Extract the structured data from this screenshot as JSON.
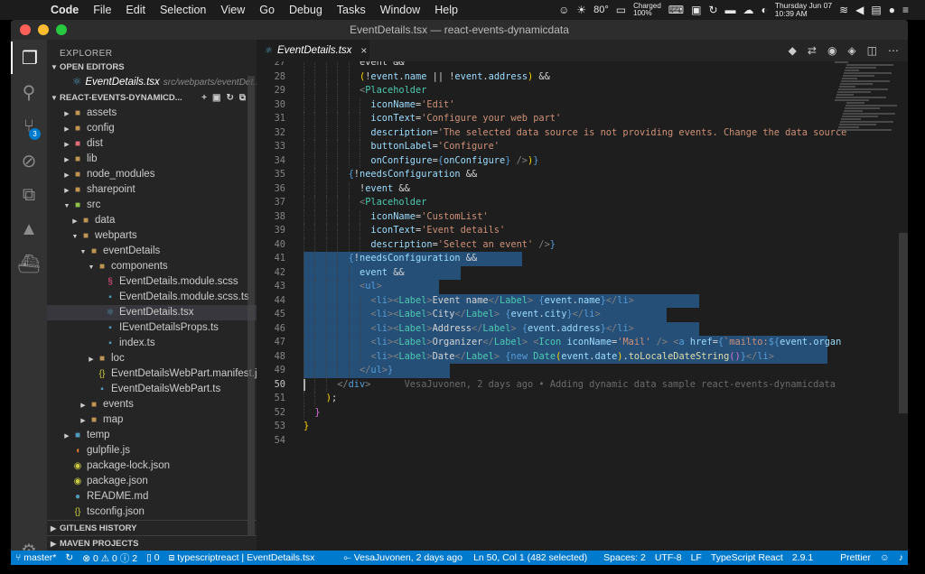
{
  "menubar": {
    "app": "Code",
    "items": [
      "File",
      "Edit",
      "Selection",
      "View",
      "Go",
      "Debug",
      "Tasks",
      "Window",
      "Help"
    ],
    "temperature": "80°",
    "battery": "Charged\n100%",
    "clock": "Thursday Jun 07\n10:39 AM"
  },
  "window": {
    "title": "EventDetails.tsx — react-events-dynamicdata"
  },
  "activity": {
    "scm_badge": "3"
  },
  "sidebar": {
    "title": "EXPLORER",
    "open_editors_label": "OPEN EDITORS",
    "open_editor_file": "EventDetails.tsx",
    "open_editor_path": "src/webparts/eventDet...",
    "project_label": "REACT-EVENTS-DYNAMICD...",
    "tree": [
      {
        "label": "assets",
        "indent": 1,
        "type": "folder",
        "twisty": "▶"
      },
      {
        "label": "config",
        "indent": 1,
        "type": "folder",
        "twisty": "▶"
      },
      {
        "label": "dist",
        "indent": 1,
        "type": "folder-red",
        "twisty": "▶"
      },
      {
        "label": "lib",
        "indent": 1,
        "type": "folder",
        "twisty": "▶"
      },
      {
        "label": "node_modules",
        "indent": 1,
        "type": "folder",
        "twisty": "▶"
      },
      {
        "label": "sharepoint",
        "indent": 1,
        "type": "folder",
        "twisty": "▶"
      },
      {
        "label": "src",
        "indent": 1,
        "type": "folder-src",
        "twisty": "▼"
      },
      {
        "label": "data",
        "indent": 2,
        "type": "folder",
        "twisty": "▶"
      },
      {
        "label": "webparts",
        "indent": 2,
        "type": "folder",
        "twisty": "▼"
      },
      {
        "label": "eventDetails",
        "indent": 3,
        "type": "folder",
        "twisty": "▼"
      },
      {
        "label": "components",
        "indent": 4,
        "type": "folder",
        "twisty": "▼"
      },
      {
        "label": "EventDetails.module.scss",
        "indent": 5,
        "type": "scss",
        "twisty": ""
      },
      {
        "label": "EventDetails.module.scss.ts",
        "indent": 5,
        "type": "ts",
        "twisty": ""
      },
      {
        "label": "EventDetails.tsx",
        "indent": 5,
        "type": "tsx",
        "twisty": "",
        "selected": true
      },
      {
        "label": "IEventDetailsProps.ts",
        "indent": 5,
        "type": "ts",
        "twisty": ""
      },
      {
        "label": "index.ts",
        "indent": 5,
        "type": "ts",
        "twisty": ""
      },
      {
        "label": "loc",
        "indent": 4,
        "type": "folder",
        "twisty": "▶"
      },
      {
        "label": "EventDetailsWebPart.manifest.j...",
        "indent": 4,
        "type": "json",
        "twisty": ""
      },
      {
        "label": "EventDetailsWebPart.ts",
        "indent": 4,
        "type": "ts",
        "twisty": ""
      },
      {
        "label": "events",
        "indent": 3,
        "type": "folder",
        "twisty": "▶"
      },
      {
        "label": "map",
        "indent": 3,
        "type": "folder",
        "twisty": "▶"
      },
      {
        "label": "temp",
        "indent": 1,
        "type": "folder-temp",
        "twisty": "▶"
      },
      {
        "label": "gulpfile.js",
        "indent": 1,
        "type": "gulp",
        "twisty": ""
      },
      {
        "label": "package-lock.json",
        "indent": 1,
        "type": "npm",
        "twisty": ""
      },
      {
        "label": "package.json",
        "indent": 1,
        "type": "npm",
        "twisty": ""
      },
      {
        "label": "README.md",
        "indent": 1,
        "type": "info",
        "twisty": ""
      },
      {
        "label": "tsconfig.json",
        "indent": 1,
        "type": "json",
        "twisty": ""
      }
    ],
    "gitlens_label": "GITLENS HISTORY",
    "maven_label": "MAVEN PROJECTS"
  },
  "editor": {
    "tab_label": "EventDetails.tsx",
    "lines": [
      {
        "n": "27",
        "html": "<span class=\"w\">event </span><span class=\"w\">&amp;&amp;</span>",
        "indent": 5
      },
      {
        "n": "28",
        "html": "<span class=\"by\">(</span><span class=\"w\">!</span><span class=\"a\">event</span><span class=\"w\">.</span><span class=\"a\">name</span><span class=\"w\"> || !</span><span class=\"a\">event</span><span class=\"w\">.</span><span class=\"a\">address</span><span class=\"by\">)</span><span class=\"w\"> &amp;&amp;</span>",
        "indent": 5
      },
      {
        "n": "29",
        "html": "<span class=\"p\">&lt;</span><span class=\"t\">Placeholder</span>",
        "indent": 5
      },
      {
        "n": "30",
        "html": "<span class=\"a\">iconName</span><span class=\"w\">=</span><span class=\"s\">'Edit'</span>",
        "indent": 6
      },
      {
        "n": "31",
        "html": "<span class=\"a\">iconText</span><span class=\"w\">=</span><span class=\"s\">'Configure your web part'</span>",
        "indent": 6
      },
      {
        "n": "32",
        "html": "<span class=\"a\">description</span><span class=\"w\">=</span><span class=\"s\">'The selected data source is not providing events. Change the data source</span>",
        "indent": 6
      },
      {
        "n": "33",
        "html": "<span class=\"a\">buttonLabel</span><span class=\"w\">=</span><span class=\"s\">'Configure'</span>",
        "indent": 6
      },
      {
        "n": "34",
        "html": "<span class=\"a\">onConfigure</span><span class=\"w\">=</span><span class=\"k\">{</span><span class=\"a\">onConfigure</span><span class=\"k\">}</span><span class=\"w\"> </span><span class=\"p\">/&gt;</span><span class=\"by\">)</span><span class=\"k\">}</span>",
        "indent": 6
      },
      {
        "n": "35",
        "html": "<span class=\"k\">{</span><span class=\"w\">!</span><span class=\"a\">needsConfiguration</span><span class=\"w\"> &amp;&amp;</span>",
        "indent": 4
      },
      {
        "n": "36",
        "html": "<span class=\"w\">!</span><span class=\"a\">event</span><span class=\"w\"> &amp;&amp;</span>",
        "indent": 5
      },
      {
        "n": "37",
        "html": "<span class=\"p\">&lt;</span><span class=\"t\">Placeholder</span>",
        "indent": 5
      },
      {
        "n": "38",
        "html": "<span class=\"a\">iconName</span><span class=\"w\">=</span><span class=\"s\">'CustomList'</span>",
        "indent": 6
      },
      {
        "n": "39",
        "html": "<span class=\"a\">iconText</span><span class=\"w\">=</span><span class=\"s\">'Event details'</span>",
        "indent": 6
      },
      {
        "n": "40",
        "html": "<span class=\"a\">description</span><span class=\"w\">=</span><span class=\"s\">'Select an event'</span><span class=\"w\"> </span><span class=\"p\">/&gt;</span><span class=\"k\">}</span>",
        "indent": 6
      },
      {
        "n": "41",
        "html": "<span class=\"k\">{</span><span class=\"w\">!</span><span class=\"a\">needsConfiguration</span><span class=\"w\"> &amp;&amp;</span>",
        "indent": 4,
        "sel": [
          0,
          192
        ]
      },
      {
        "n": "42",
        "html": "<span class=\"a\">event</span><span class=\"w\"> &amp;&amp;</span>",
        "indent": 5,
        "sel": [
          0,
          112
        ]
      },
      {
        "n": "43",
        "html": "<span class=\"p\">&lt;</span><span class=\"k\">ul</span><span class=\"p\">&gt;</span>",
        "indent": 5,
        "sel": [
          0,
          88
        ]
      },
      {
        "n": "44",
        "html": "<span class=\"p\">&lt;</span><span class=\"k\">li</span><span class=\"p\">&gt;&lt;</span><span class=\"t\">Label</span><span class=\"p\">&gt;</span><span class=\"w\">Event name</span><span class=\"p\">&lt;/</span><span class=\"t\">Label</span><span class=\"p\">&gt;</span><span class=\"w\"> </span><span class=\"k\">{</span><span class=\"a\">event</span><span class=\"w\">.</span><span class=\"a\">name</span><span class=\"k\">}</span><span class=\"p\">&lt;/</span><span class=\"k\">li</span><span class=\"p\">&gt;</span>",
        "indent": 6,
        "sel": [
          0,
          364
        ]
      },
      {
        "n": "45",
        "html": "<span class=\"p\">&lt;</span><span class=\"k\">li</span><span class=\"p\">&gt;&lt;</span><span class=\"t\">Label</span><span class=\"p\">&gt;</span><span class=\"w\">City</span><span class=\"p\">&lt;/</span><span class=\"t\">Label</span><span class=\"p\">&gt;</span><span class=\"w\"> </span><span class=\"k\">{</span><span class=\"a\">event</span><span class=\"w\">.</span><span class=\"a\">city</span><span class=\"k\">}</span><span class=\"p\">&lt;/</span><span class=\"k\">li</span><span class=\"p\">&gt;</span>",
        "indent": 6,
        "sel": [
          0,
          328
        ]
      },
      {
        "n": "46",
        "html": "<span class=\"p\">&lt;</span><span class=\"k\">li</span><span class=\"p\">&gt;&lt;</span><span class=\"t\">Label</span><span class=\"p\">&gt;</span><span class=\"w\">Address</span><span class=\"p\">&lt;/</span><span class=\"t\">Label</span><span class=\"p\">&gt;</span><span class=\"w\"> </span><span class=\"k\">{</span><span class=\"a\">event</span><span class=\"w\">.</span><span class=\"a\">address</span><span class=\"k\">}</span><span class=\"p\">&lt;/</span><span class=\"k\">li</span><span class=\"p\">&gt;</span>",
        "indent": 6,
        "sel": [
          0,
          364
        ]
      },
      {
        "n": "47",
        "html": "<span class=\"p\">&lt;</span><span class=\"k\">li</span><span class=\"p\">&gt;&lt;</span><span class=\"t\">Label</span><span class=\"p\">&gt;</span><span class=\"w\">Organizer</span><span class=\"p\">&lt;/</span><span class=\"t\">Label</span><span class=\"p\">&gt;</span><span class=\"w\"> </span><span class=\"p\">&lt;</span><span class=\"t\">Icon</span><span class=\"w\"> </span><span class=\"a\">iconName</span><span class=\"w\">=</span><span class=\"s\">'Mail'</span><span class=\"w\"> </span><span class=\"p\">/&gt;</span><span class=\"w\"> </span><span class=\"p\">&lt;</span><span class=\"k\">a</span><span class=\"w\"> </span><span class=\"a\">href</span><span class=\"w\">=</span><span class=\"k\">{</span><span class=\"s\">`mailto:</span><span class=\"k\">${</span><span class=\"a\">event</span><span class=\"w\">.</span><span class=\"a\">organ</span>",
        "indent": 6,
        "sel": [
          0,
          580
        ]
      },
      {
        "n": "48",
        "html": "<span class=\"p\">&lt;</span><span class=\"k\">li</span><span class=\"p\">&gt;&lt;</span><span class=\"t\">Label</span><span class=\"p\">&gt;</span><span class=\"w\">Date</span><span class=\"p\">&lt;/</span><span class=\"t\">Label</span><span class=\"p\">&gt;</span><span class=\"w\"> </span><span class=\"k\">{new</span><span class=\"w\"> </span><span class=\"t\">Date</span><span class=\"by\">(</span><span class=\"a\">event</span><span class=\"w\">.</span><span class=\"a\">date</span><span class=\"by\">)</span><span class=\"w\">.</span><span class=\"f\">toLocaleDateString</span><span class=\"br\">()</span><span class=\"k\">}</span><span class=\"p\">&lt;/</span><span class=\"k\">li</span><span class=\"p\">&gt;</span>",
        "indent": 6,
        "sel": [
          0,
          516
        ]
      },
      {
        "n": "49",
        "html": "<span class=\"p\">&lt;/</span><span class=\"k\">ul</span><span class=\"p\">&gt;</span><span class=\"k\">}</span>",
        "indent": 5,
        "sel": [
          0,
          100
        ]
      },
      {
        "n": "50",
        "html": "<span class=\"p\">&lt;/</span><span class=\"k\">div</span><span class=\"p\">&gt;</span><span class=\"blame\">      VesaJuvonen, 2 days ago • Adding dynamic data sample react-events-dynamicdata</span>",
        "indent": 3,
        "current": true
      },
      {
        "n": "51",
        "html": "<span class=\"by\">)</span><span class=\"w\">;</span>",
        "indent": 2
      },
      {
        "n": "52",
        "html": "<span class=\"br\">}</span>",
        "indent": 1
      },
      {
        "n": "53",
        "html": "<span class=\"by\">}</span>",
        "indent": 0
      },
      {
        "n": "54",
        "html": "",
        "indent": 0
      }
    ]
  },
  "statusbar": {
    "branch": "master*",
    "errors": "0",
    "warnings": "0",
    "info": "2",
    "other": "0",
    "language_service": "typescriptreact",
    "file": "EventDetails.tsx",
    "blame": "VesaJuvonen, 2 days ago",
    "position": "Ln 50, Col 1 (482 selected)",
    "spaces": "Spaces: 2",
    "encoding": "UTF-8",
    "eol": "LF",
    "language": "TypeScript React",
    "version": "2.9.1",
    "formatter": "Prettier"
  }
}
